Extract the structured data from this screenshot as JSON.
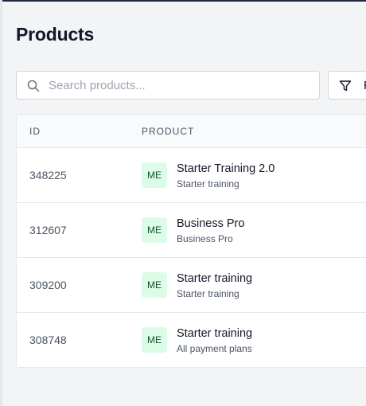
{
  "page": {
    "title": "Products"
  },
  "search": {
    "placeholder": "Search products...",
    "value": ""
  },
  "filter": {
    "label": "F",
    "icon": "filter-icon"
  },
  "table": {
    "headers": {
      "id": "ID",
      "product": "PRODUCT"
    },
    "rows": [
      {
        "id": "348225",
        "avatar": "ME",
        "name": "Starter Training 2.0",
        "subtitle": "Starter training"
      },
      {
        "id": "312607",
        "avatar": "ME",
        "name": "Business Pro",
        "subtitle": "Business Pro"
      },
      {
        "id": "309200",
        "avatar": "ME",
        "name": "Starter training",
        "subtitle": "Starter training"
      },
      {
        "id": "308748",
        "avatar": "ME",
        "name": "Starter training",
        "subtitle": "All payment plans"
      }
    ]
  },
  "colors": {
    "avatar_bg": "#dcfce7",
    "avatar_text": "#14532d",
    "page_bg": "#f3f4f6"
  }
}
